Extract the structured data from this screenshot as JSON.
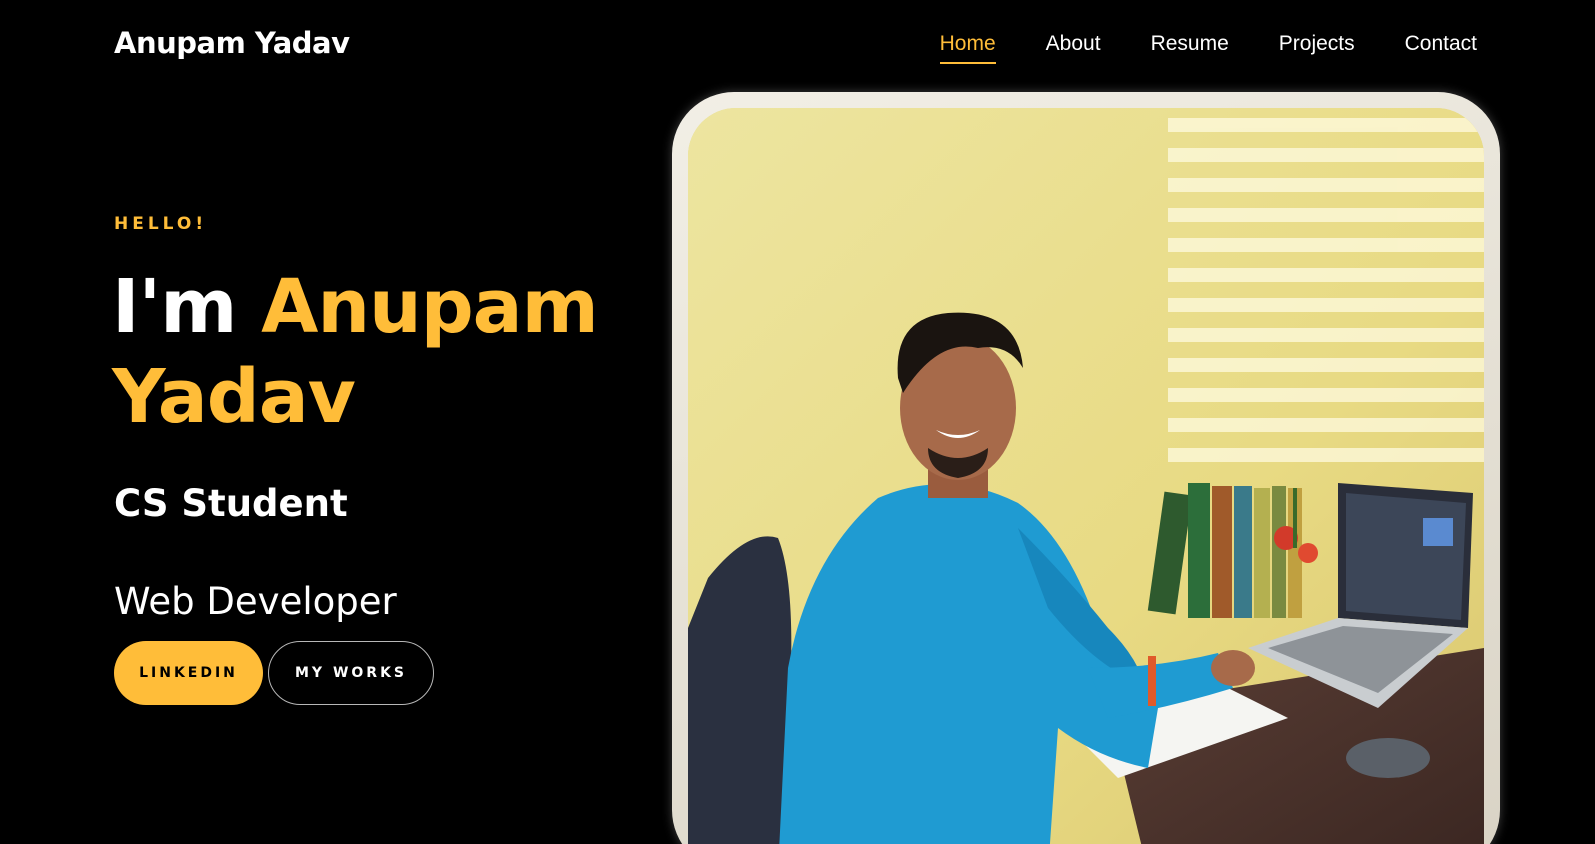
{
  "header": {
    "logo": "Anupam Yadav",
    "nav": [
      "Home",
      "About",
      "Resume",
      "Projects",
      "Contact"
    ],
    "active": "Home"
  },
  "hero": {
    "greeting": "HELLO!",
    "intro": "I'm",
    "first_name": "Anupam",
    "last_name": "Yadav",
    "role_primary": "CS Student",
    "role_secondary": "Web Developer",
    "buttons": {
      "linkedin": "LINKEDIN",
      "works": "MY WORKS"
    }
  },
  "photo": {
    "icon": "profile-photo"
  },
  "colors": {
    "accent": "#ffbd39",
    "background": "#000000",
    "text": "#ffffff"
  }
}
